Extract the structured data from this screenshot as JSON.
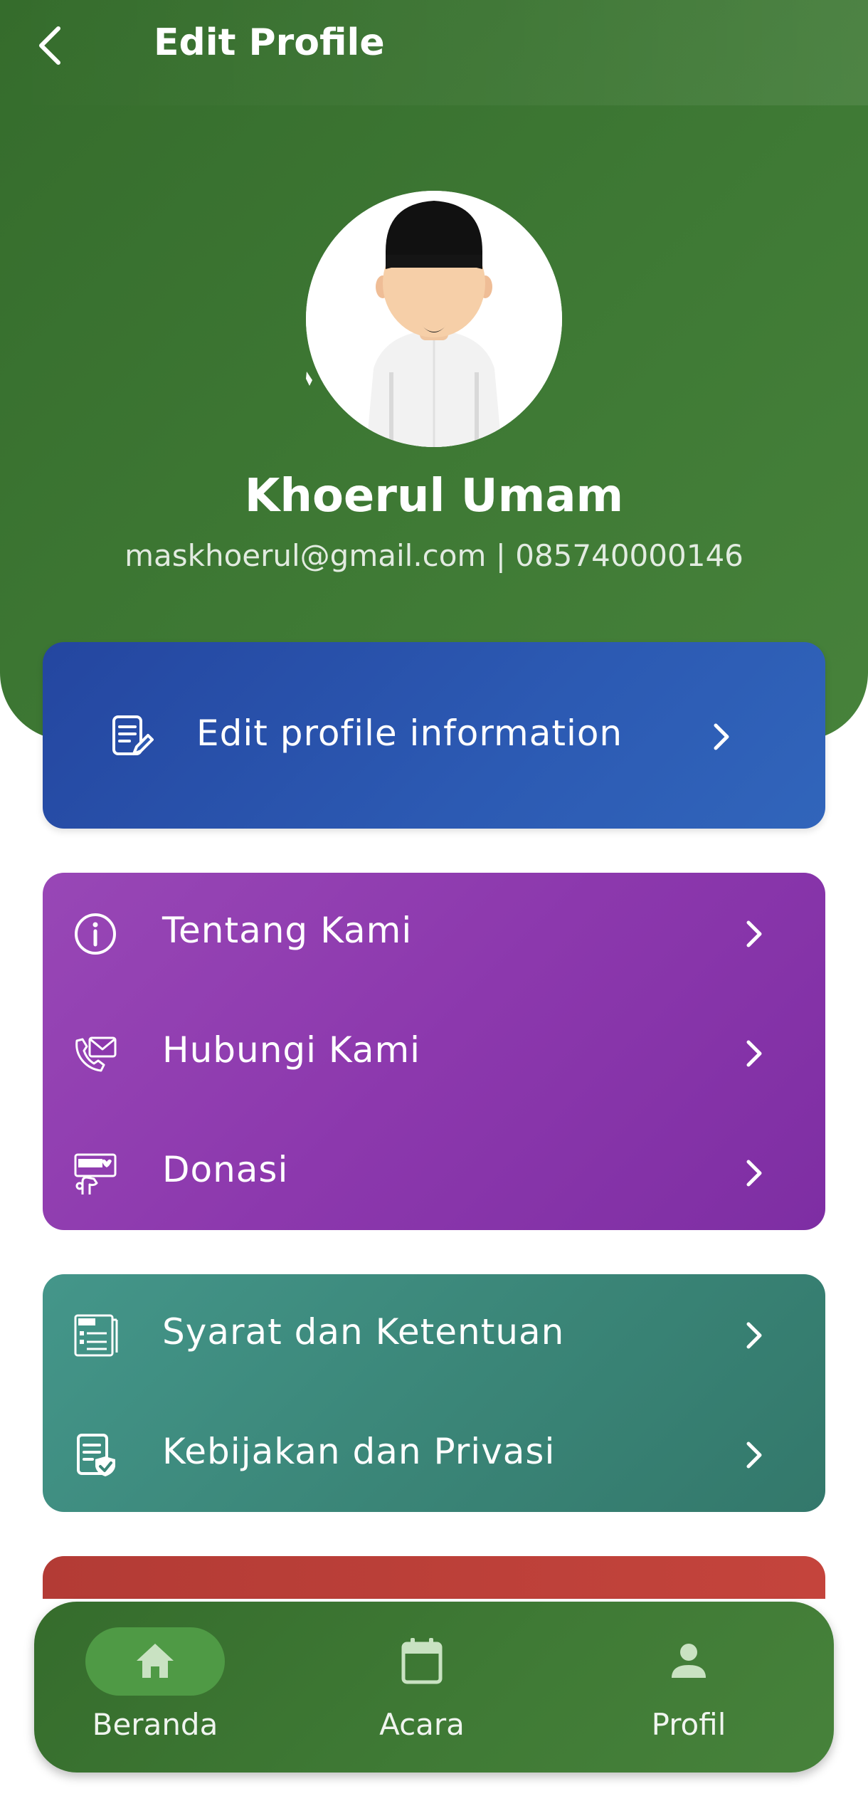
{
  "header": {
    "title": "Edit Profile",
    "back_icon": "chevron-left-icon"
  },
  "profile": {
    "name": "Khoerul Umam",
    "contact": "maskhoerul@gmail.com | 085740000146",
    "avatar_icon": "avatar-illustration"
  },
  "edit_card": {
    "label": "Edit profile information",
    "icon": "edit-document-icon"
  },
  "info_card": {
    "items": [
      {
        "label": "Tentang Kami",
        "icon": "info-icon"
      },
      {
        "label": "Hubungi Kami",
        "icon": "contact-mail-icon"
      },
      {
        "label": "Donasi",
        "icon": "donate-icon"
      }
    ]
  },
  "legal_card": {
    "items": [
      {
        "label": "Syarat dan Ketentuan",
        "icon": "terms-icon"
      },
      {
        "label": "Kebijakan dan Privasi",
        "icon": "privacy-policy-icon"
      }
    ]
  },
  "bottom_nav": {
    "items": [
      {
        "label": "Beranda",
        "icon": "home-icon",
        "active": true
      },
      {
        "label": "Acara",
        "icon": "calendar-icon",
        "active": false
      },
      {
        "label": "Profil",
        "icon": "person-icon",
        "active": false
      }
    ]
  },
  "colors": {
    "primary_green": "#3f7a35",
    "edit_card_blue": "#2c5ab3",
    "info_card_purple": "#8c38ad",
    "legal_card_teal": "#3a8577",
    "danger_red": "#c4443c",
    "active_pill": "#4f9a45"
  }
}
